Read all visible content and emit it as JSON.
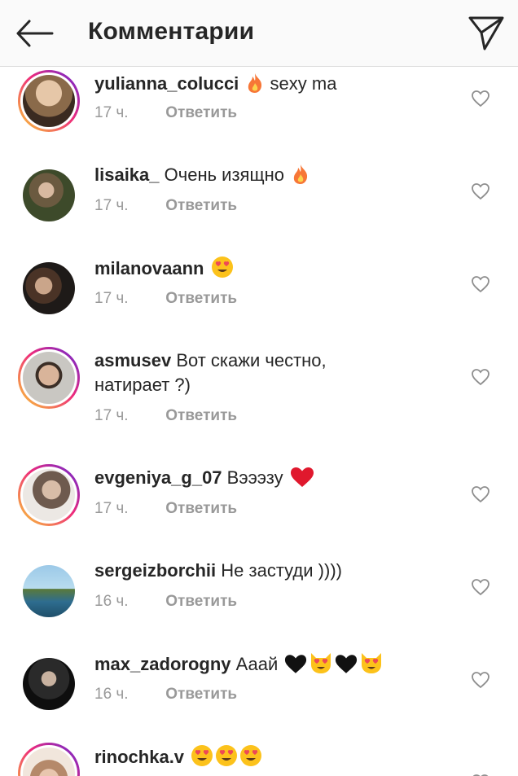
{
  "header": {
    "title": "Комментарии"
  },
  "comments": [
    {
      "username": "yulianna_colucci",
      "text": "sexy ma",
      "time": "17 ч.",
      "reply": "Ответить",
      "story_ring": true
    },
    {
      "username": "lisaika_",
      "text": "Очень изящно",
      "time": "17 ч.",
      "reply": "Ответить",
      "story_ring": false
    },
    {
      "username": "milanovaann",
      "text": "",
      "time": "17 ч.",
      "reply": "Ответить",
      "story_ring": false
    },
    {
      "username": "asmusev",
      "text": "Вот скажи честно,",
      "text2": "натирает ?)",
      "time": "17 ч.",
      "reply": "Ответить",
      "story_ring": true
    },
    {
      "username": "evgeniya_g_07",
      "text": "Вэээзу",
      "time": "17 ч.",
      "reply": "Ответить",
      "story_ring": true
    },
    {
      "username": "sergeizborchii",
      "text": "Не застуди ))))",
      "time": "16 ч.",
      "reply": "Ответить",
      "story_ring": false
    },
    {
      "username": "max_zadorogny",
      "text": "Ааай",
      "time": "16 ч.",
      "reply": "Ответить",
      "story_ring": false
    },
    {
      "username": "rinochka.v",
      "text": "",
      "time": "",
      "reply": "",
      "story_ring": true
    }
  ],
  "colors": {
    "accent_link": "#999999",
    "text": "#262626",
    "heart_outline": "#8e8e8e",
    "red_heart": "#ed4956",
    "fire": "#f77737"
  },
  "icons": [
    "back-arrow-icon",
    "direct-send-icon",
    "heart-outline-icon",
    "fire-emoji",
    "heart-eyes-emoji",
    "red-heart-emoji",
    "black-heart-emoji",
    "heart-eyes-cat-emoji"
  ]
}
